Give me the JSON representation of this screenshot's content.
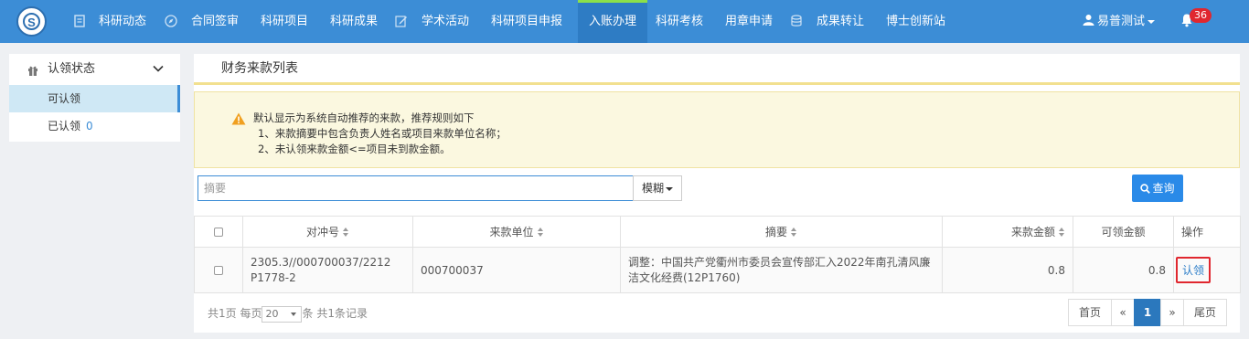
{
  "nav": {
    "items": [
      {
        "label": "科研动态"
      },
      {
        "label": "合同签审"
      },
      {
        "label": "科研项目"
      },
      {
        "label": "科研成果"
      },
      {
        "label": "学术活动"
      },
      {
        "label": "科研项目申报"
      },
      {
        "label": "入账办理"
      },
      {
        "label": "科研考核"
      },
      {
        "label": "用章申请"
      },
      {
        "label": "成果转让"
      },
      {
        "label": "博士创新站"
      }
    ],
    "user": "易普测试",
    "notification_count": "36"
  },
  "sidebar": {
    "title": "认领状态",
    "items": [
      {
        "label": "可认领"
      },
      {
        "label": "已认领",
        "count": "0"
      }
    ]
  },
  "main": {
    "title": "财务来款列表",
    "notice": {
      "lines": [
        "默认显示为系统自动推荐的来款，推荐规则如下",
        "1、来款摘要中包含负责人姓名或项目来款单位名称；",
        "2、未认领来款金额<=项目未到款金额。"
      ]
    },
    "search": {
      "placeholder": "摘要",
      "mode": "模糊",
      "button": "查询"
    },
    "table": {
      "headers": [
        "对冲号",
        "来款单位",
        "摘要",
        "来款金额",
        "可领金额",
        "操作"
      ],
      "rows": [
        {
          "offset_no": "2305.3//000700037/2212 P1778-2",
          "unit": "000700037",
          "summary": "调整：中国共产党衢州市委员会宣传部汇入2022年南孔清风廉洁文化经费(12P1760)",
          "amount": "0.8",
          "claimable": "0.8",
          "action": "认领"
        }
      ]
    },
    "footer": {
      "pages": "共1页",
      "per_page_label": "每页",
      "per_page": "20",
      "unit": "条",
      "records": "共1条记录"
    },
    "pager": {
      "first": "首页",
      "prev": "«",
      "current": "1",
      "next": "»",
      "last": "尾页"
    }
  }
}
